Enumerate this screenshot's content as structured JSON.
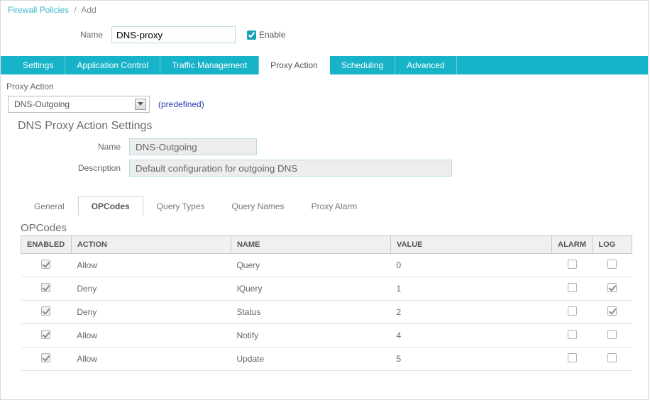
{
  "breadcrumb": {
    "root": "Firewall Policies",
    "current": "Add"
  },
  "policy": {
    "name_label": "Name",
    "name_value": "DNS-proxy",
    "enable_label": "Enable",
    "enable_checked": true
  },
  "main_tabs": {
    "t0": "Settings",
    "t1": "Application Control",
    "t2": "Traffic Management",
    "t3": "Proxy Action",
    "t4": "Scheduling",
    "t5": "Advanced",
    "active_index": 3
  },
  "proxy_action": {
    "label": "Proxy Action",
    "selected": "DNS-Outgoing",
    "predefined_text": "(predefined)"
  },
  "settings_section": {
    "heading": "DNS Proxy Action Settings",
    "name_label": "Name",
    "name_value": "DNS-Outgoing",
    "desc_label": "Description",
    "desc_value": "Default configuration for outgoing DNS"
  },
  "sub_tabs": {
    "s0": "General",
    "s1": "OPCodes",
    "s2": "Query Types",
    "s3": "Query Names",
    "s4": "Proxy Alarm",
    "active_index": 1
  },
  "opcodes": {
    "heading": "OPCodes",
    "columns": {
      "enabled": "ENABLED",
      "action": "ACTION",
      "name": "NAME",
      "value": "VALUE",
      "alarm": "ALARM",
      "log": "LOG"
    },
    "rows": [
      {
        "enabled": true,
        "action": "Allow",
        "name": "Query",
        "value": "0",
        "alarm": false,
        "log": false
      },
      {
        "enabled": true,
        "action": "Deny",
        "name": "IQuery",
        "value": "1",
        "alarm": false,
        "log": true
      },
      {
        "enabled": true,
        "action": "Deny",
        "name": "Status",
        "value": "2",
        "alarm": false,
        "log": true
      },
      {
        "enabled": true,
        "action": "Allow",
        "name": "Notify",
        "value": "4",
        "alarm": false,
        "log": false
      },
      {
        "enabled": true,
        "action": "Allow",
        "name": "Update",
        "value": "5",
        "alarm": false,
        "log": false
      }
    ]
  }
}
